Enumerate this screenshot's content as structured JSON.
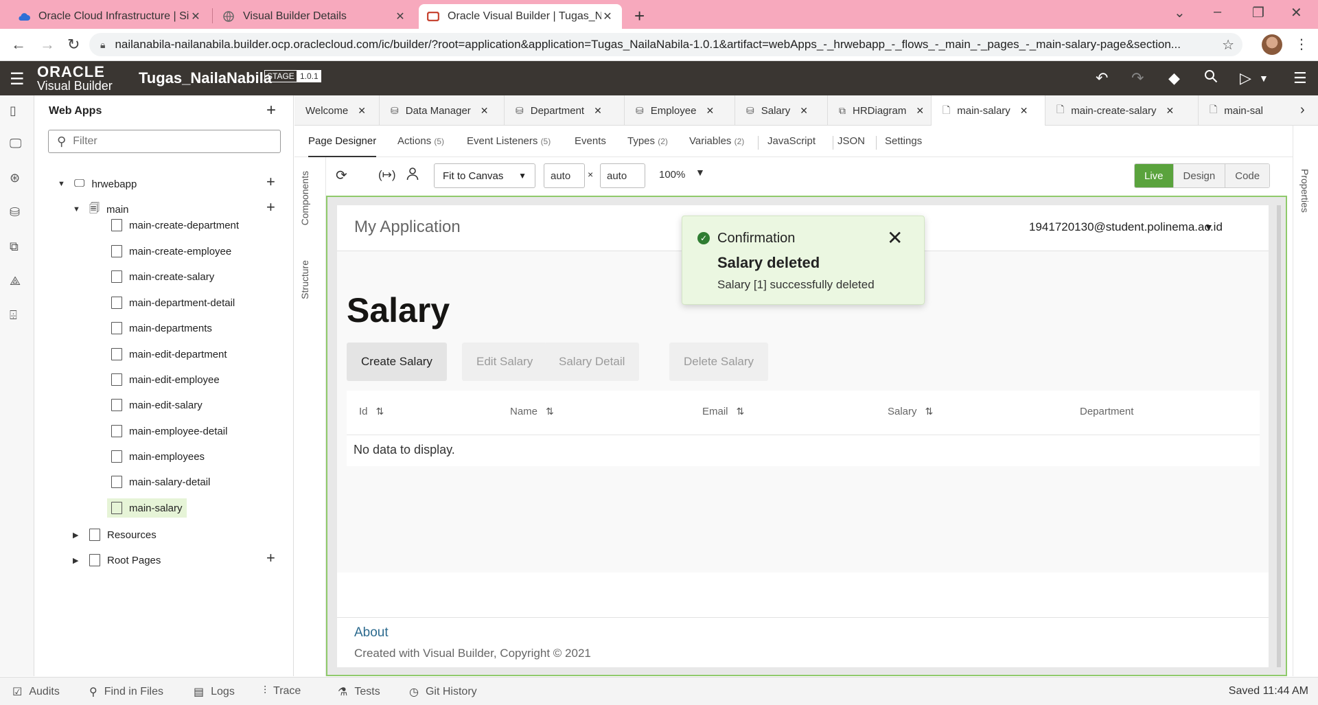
{
  "browser": {
    "tabs": [
      {
        "title": "Oracle Cloud Infrastructure | Sign",
        "icon": "cloud-icon"
      },
      {
        "title": "Visual Builder Details",
        "icon": "globe-icon"
      },
      {
        "title": "Oracle Visual Builder | Tugas_Nai",
        "icon": "oracle-icon"
      }
    ],
    "url": "nailanabila-nailanabila.builder.ocp.oraclecloud.com/ic/builder/?root=application&application=Tugas_NailaNabila-1.0.1&artifact=webApps_-_hrwebapp_-_flows_-_main_-_pages_-_main-salary-page&section..."
  },
  "vb": {
    "logo_top": "ORACLE",
    "logo_bottom": "Visual Builder",
    "app_name": "Tugas_NailaNabila",
    "stage": "STAGE",
    "version": "1.0.1"
  },
  "navigator": {
    "title": "Web Apps",
    "filter_placeholder": "Filter",
    "webapp": "hrwebapp",
    "flow": "main",
    "pages": [
      "main-create-department",
      "main-create-employee",
      "main-create-salary",
      "main-department-detail",
      "main-departments",
      "main-edit-department",
      "main-edit-employee",
      "main-edit-salary",
      "main-employee-detail",
      "main-employees",
      "main-salary-detail",
      "main-salary"
    ],
    "resources": "Resources",
    "root_pages": "Root Pages"
  },
  "editor_tabs": [
    "Welcome",
    "Data Manager",
    "Department",
    "Employee",
    "Salary",
    "HRDiagram",
    "main-salary",
    "main-create-salary",
    "main-sal"
  ],
  "sub_tabs": [
    {
      "label": "Page Designer",
      "count": ""
    },
    {
      "label": "Actions",
      "count": "(5)"
    },
    {
      "label": "Event Listeners",
      "count": "(5)"
    },
    {
      "label": "Events",
      "count": ""
    },
    {
      "label": "Types",
      "count": "(2)"
    },
    {
      "label": "Variables",
      "count": "(2)"
    },
    {
      "label": "JavaScript",
      "count": ""
    },
    {
      "label": "JSON",
      "count": ""
    },
    {
      "label": "Settings",
      "count": ""
    }
  ],
  "side_labels": {
    "components": "Components",
    "structure": "Structure",
    "properties": "Properties"
  },
  "toolbar": {
    "fit": "Fit to Canvas",
    "width": "auto",
    "height": "auto",
    "times": "×",
    "zoom": "100%",
    "modes": [
      "Live",
      "Design",
      "Code"
    ]
  },
  "app_page": {
    "app_title": "My Application",
    "user": "1941720130@student.polinema.ac.id",
    "heading": "Salary",
    "buttons": [
      "Create Salary",
      "Edit Salary",
      "Salary Detail",
      "Delete Salary"
    ],
    "columns": [
      "Id",
      "Name",
      "Email",
      "Salary",
      "Department"
    ],
    "empty": "No data to display.",
    "footer_link": "About",
    "footer_text": "Created with Visual Builder, Copyright © 2021"
  },
  "toast": {
    "title": "Confirmation",
    "summary": "Salary deleted",
    "detail": "Salary [1] successfully deleted"
  },
  "bottom_bar": {
    "items": [
      "Audits",
      "Find in Files",
      "Logs",
      "Trace",
      "Tests",
      "Git History"
    ],
    "status": "Saved 11:44 AM"
  },
  "colors": {
    "browser_tabbar": "#f7a9bd",
    "vb_header": "#3a3632",
    "live_mode": "#5aa33d",
    "toast_bg": "#ebf7e1",
    "selected_row": "#e6f4d7"
  }
}
